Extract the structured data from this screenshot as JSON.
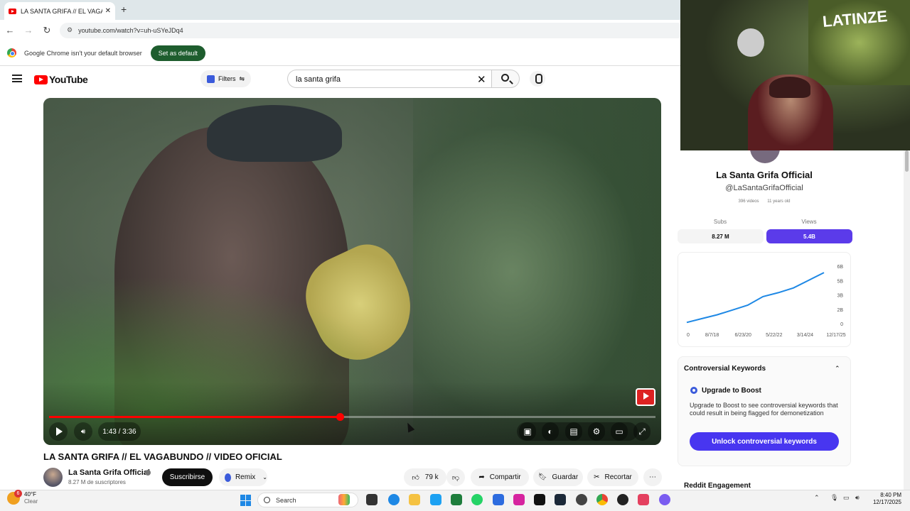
{
  "browser": {
    "tab_title": "LA SANTA GRIFA // EL VAGABUNDO",
    "url": "youtube.com/watch?v=uh-uSYeJDq4",
    "infobar_text": "Google Chrome isn't your default browser",
    "set_default": "Set as default"
  },
  "youtube": {
    "logo": "YouTube",
    "filters": "Filters",
    "search_value": "la santa grifa",
    "video_time": "1:43 / 3:36",
    "progress_fraction": 0.48,
    "video_title": "LA SANTA GRIFA // EL VAGABUNDO // VIDEO OFICIAL",
    "channel_name": "La Santa Grifa Official",
    "subscribers": "8.27 M de suscriptores",
    "subscribe": "Suscribirse",
    "remix": "Remix",
    "likes": "79 k",
    "share": "Compartir",
    "save": "Guardar",
    "clip": "Recortar"
  },
  "sidebar": {
    "channel_name": "La Santa Grifa Official",
    "handle": "@LaSantaGrifaOfficial",
    "videos": "396 videos",
    "age": "11 years old",
    "subs_label": "Subs",
    "views_label": "Views",
    "subs_value": "8.27 M",
    "views_value": "5.4B",
    "controversial_title": "Controversial Keywords",
    "upgrade_title": "Upgrade to Boost",
    "upgrade_text": "Upgrade to Boost to see controversial keywords that could result in being flagged for demonetization",
    "unlock_button": "Unlock controversial keywords",
    "reddit_title": "Reddit Engagement"
  },
  "chart_data": {
    "type": "line",
    "x": [
      "8/7/18",
      "6/23/20",
      "5/22/22",
      "3/14/24",
      "12/17/25"
    ],
    "xlabels": [
      "0",
      "8/7/18",
      "6/23/20",
      "5/22/22",
      "3/14/24",
      "12/17/25"
    ],
    "ylabels": [
      "6B",
      "5B",
      "3B",
      "2B",
      "0"
    ],
    "series": [
      {
        "values": [
          0.2,
          0.6,
          1.0,
          1.5,
          2.0,
          2.9,
          3.3,
          3.8,
          4.6,
          5.4
        ]
      }
    ],
    "ylim": [
      0,
      6
    ],
    "color": "#1e88e5"
  },
  "taskbar": {
    "temperature": "40°F",
    "condition": "Clear",
    "weather_badge": "6",
    "search": "Search",
    "time": "8:40 PM",
    "date": "12/17/2025"
  },
  "webcam": {
    "overlay_text": "LATINZE"
  }
}
